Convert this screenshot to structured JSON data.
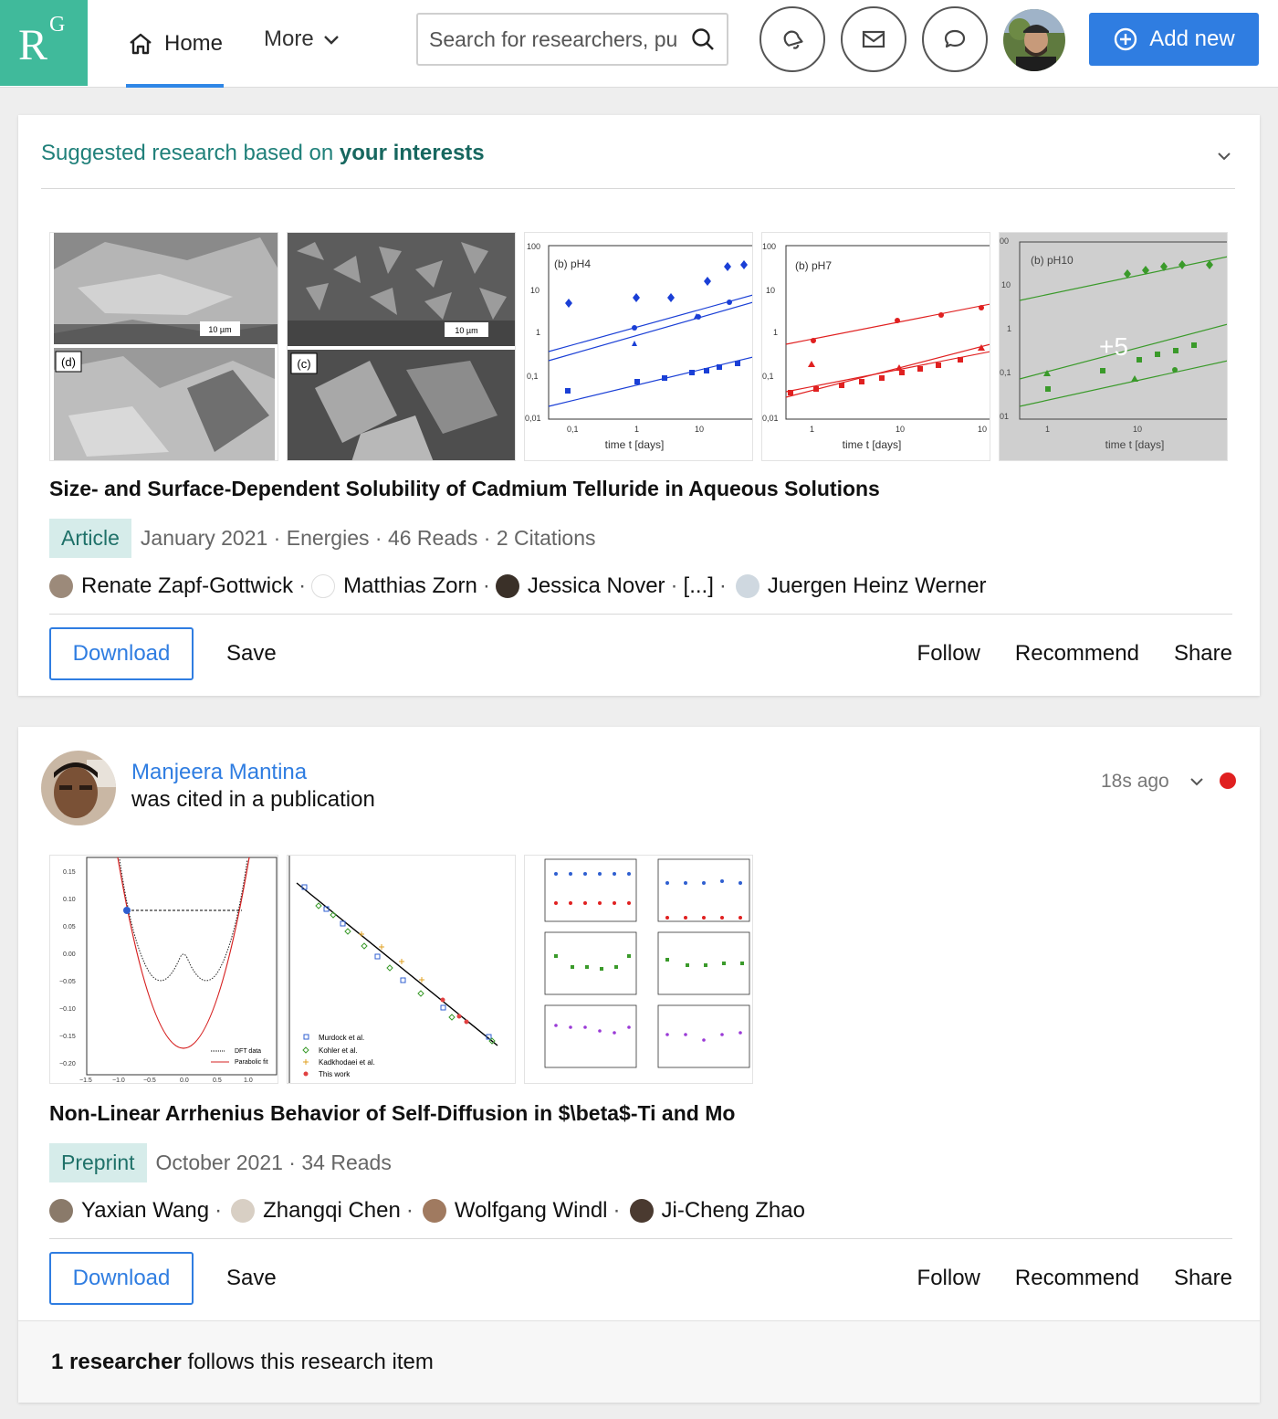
{
  "header": {
    "logo_r": "R",
    "logo_g": "G",
    "home_label": "Home",
    "more_label": "More",
    "search_placeholder": "Search for researchers, pu",
    "add_new_label": "Add new"
  },
  "suggested": {
    "heading_prefix": "Suggested research based on ",
    "heading_bold": "your interests",
    "thumb_more": "+5",
    "thumb_plots": [
      {
        "label": "(b) pH4",
        "color": "#1a3fd6"
      },
      {
        "label": "(b) pH7",
        "color": "#e02020"
      },
      {
        "label": "(b) pH10",
        "color": "#3a9a2a"
      }
    ],
    "thumb_axis": "time t [days]",
    "panel_labels": {
      "d": "(d)",
      "c": "(c)",
      "scale": "10 µm"
    },
    "title": "Size- and Surface-Dependent Solubility of Cadmium Telluride in Aqueous Solutions",
    "type": "Article",
    "meta": "January 2021 · Energies · 46 Reads · 2 Citations",
    "authors": [
      "Renate Zapf-Gottwick",
      "Matthias Zorn",
      "Jessica Nover",
      "[...]",
      "Juergen Heinz Werner"
    ],
    "download": "Download",
    "save": "Save",
    "follow": "Follow",
    "recommend": "Recommend",
    "share": "Share"
  },
  "feed": {
    "name": "Manjeera Mantina",
    "action": "was cited in a publication",
    "time": "18s ago",
    "title": "Non-Linear Arrhenius Behavior of Self-Diffusion in $\\beta$-Ti and Mo",
    "type": "Preprint",
    "meta": "October 2021 · 34 Reads",
    "authors": [
      "Yaxian Wang",
      "Zhangqi Chen",
      "Wolfgang Windl",
      "Ji-Cheng Zhao"
    ],
    "legend1": [
      "DFT data",
      "Parabolic fit"
    ],
    "legend2": [
      "Murdock et al.",
      "Kohler et al.",
      "Kadkhodaei et al.",
      "This work"
    ],
    "download": "Download",
    "save": "Save",
    "follow": "Follow",
    "recommend": "Recommend",
    "share": "Share",
    "footer_bold": "1 researcher",
    "footer_rest": " follows this research item"
  }
}
